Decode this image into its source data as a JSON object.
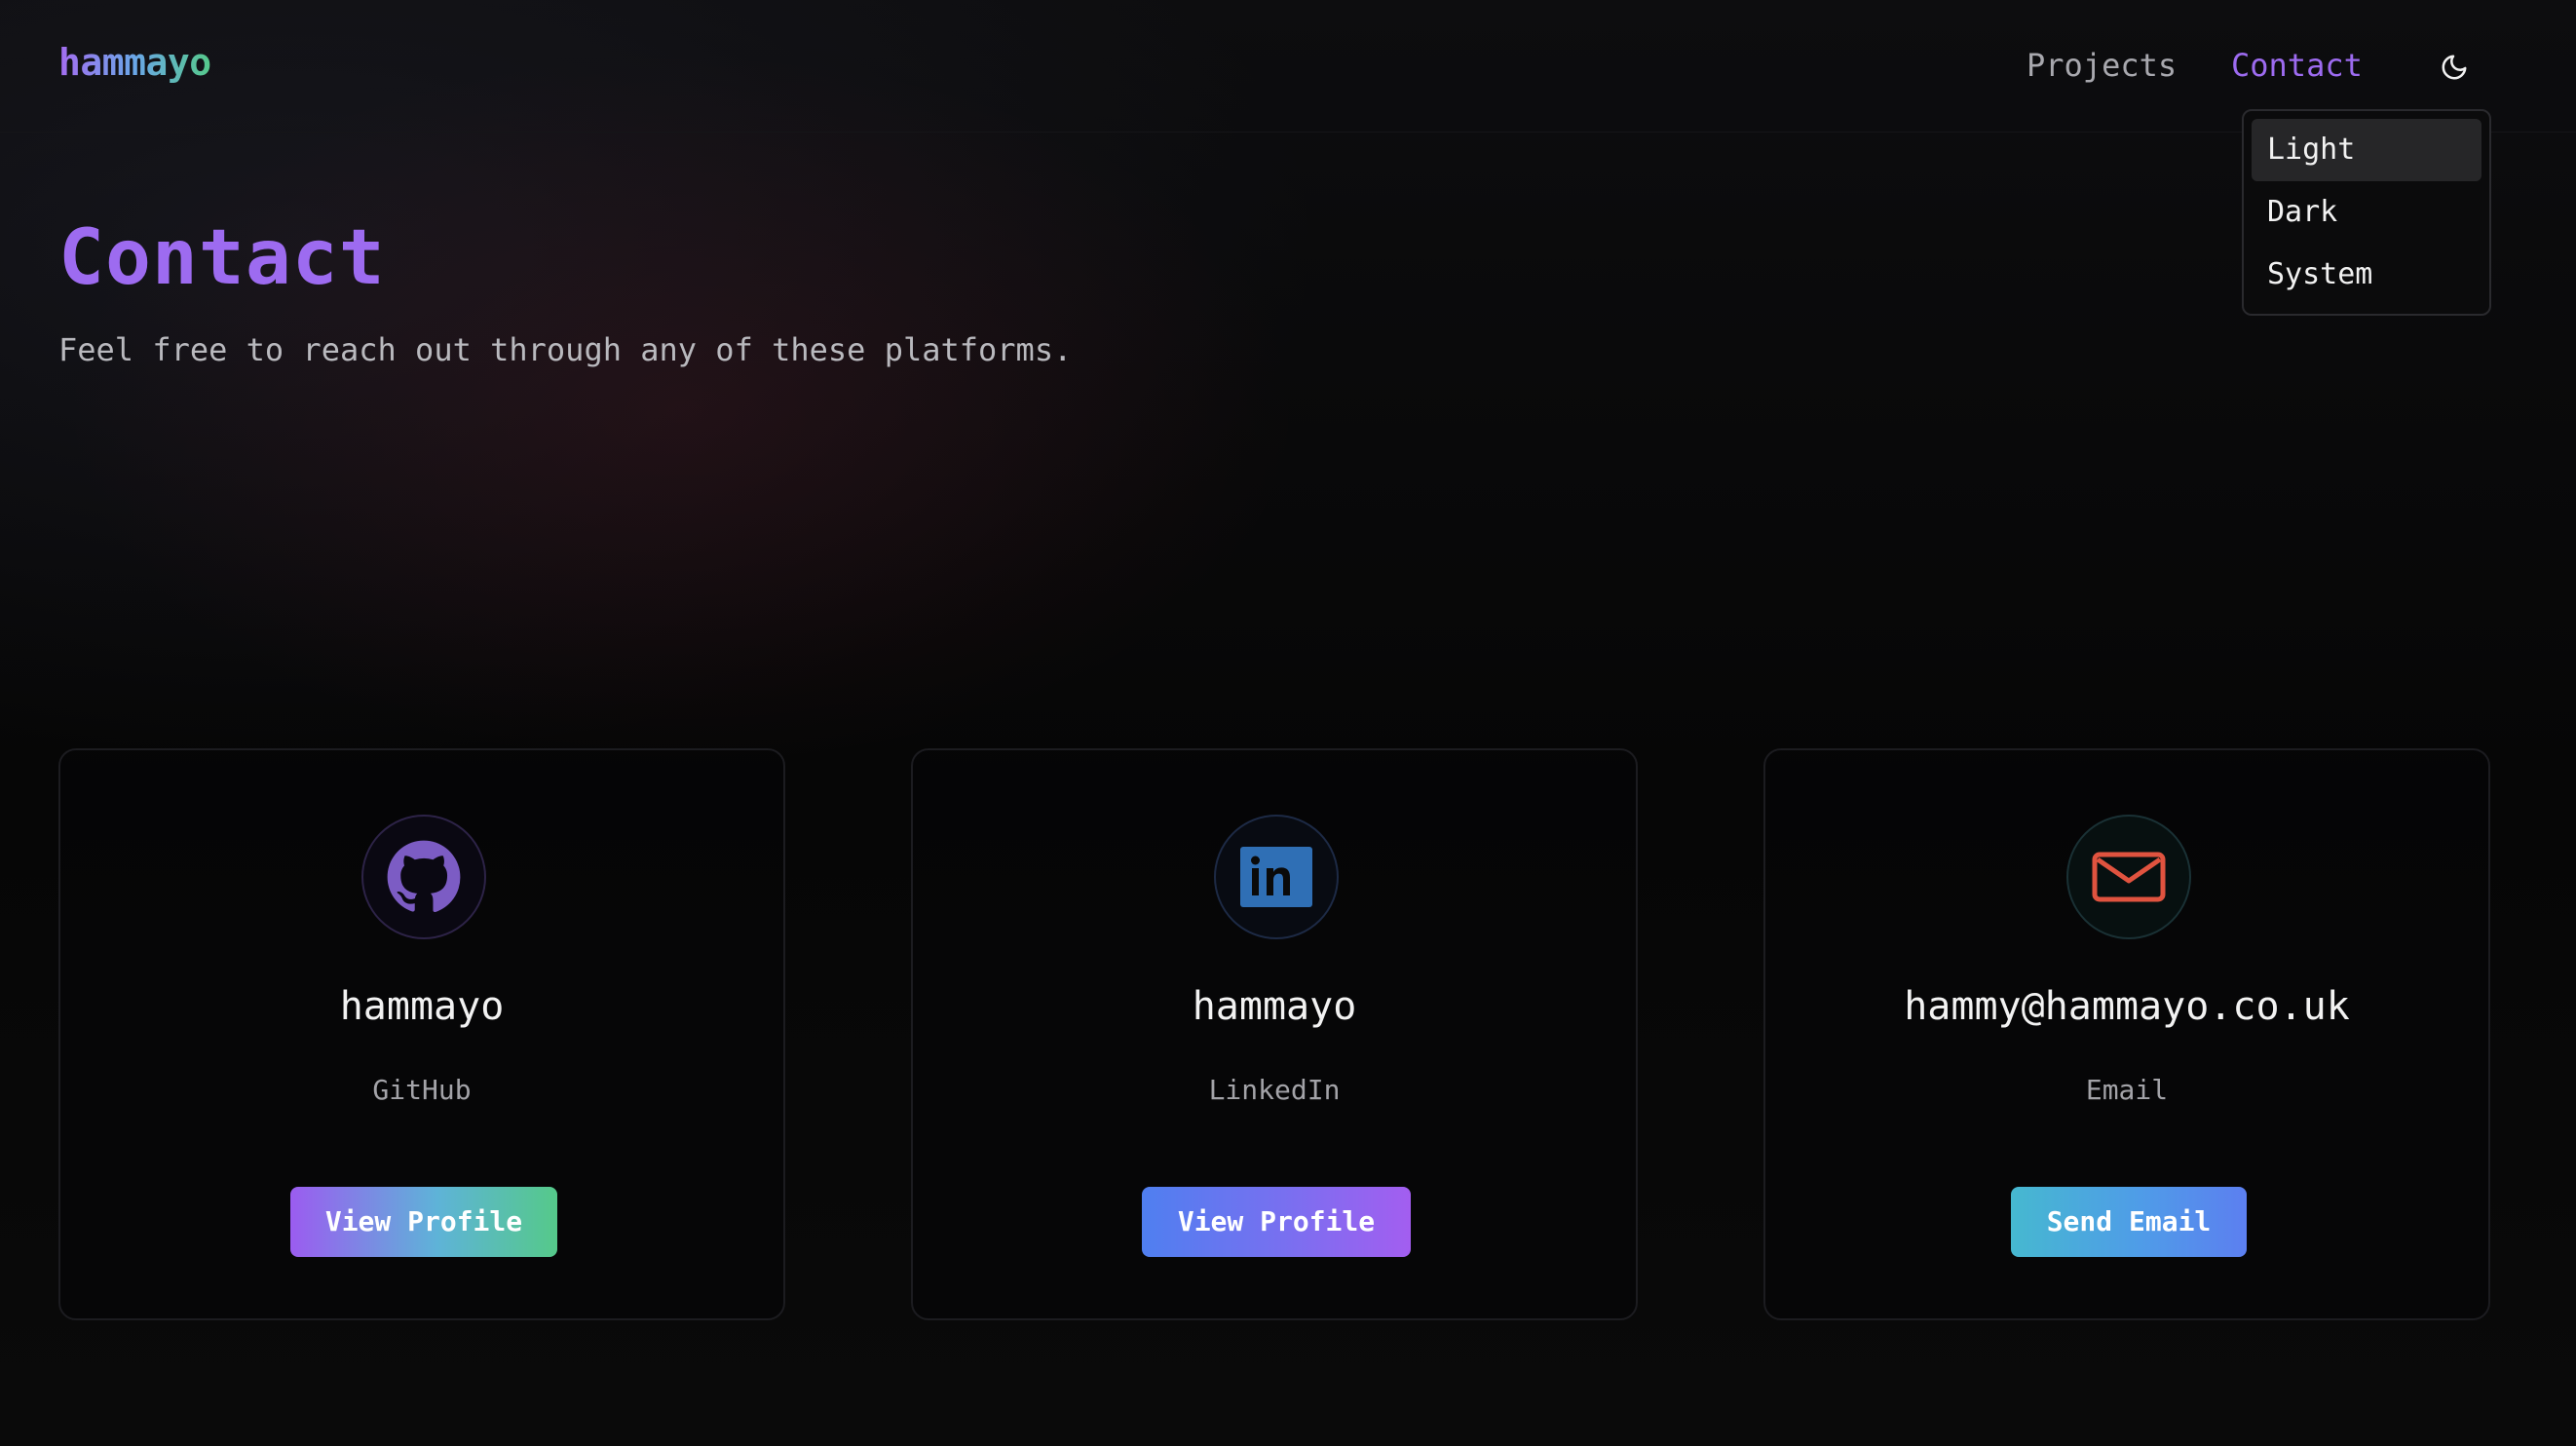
{
  "header": {
    "logo": "hammayo",
    "nav": {
      "projects": "Projects",
      "contact": "Contact"
    },
    "theme_toggle_icon": "moon-icon"
  },
  "theme_menu": {
    "items": [
      "Light",
      "Dark",
      "System"
    ],
    "highlighted": "Light"
  },
  "main": {
    "title": "Contact",
    "subtitle": "Feel free to reach out through any of these platforms."
  },
  "cards": [
    {
      "icon": "github-icon",
      "name": "hammayo",
      "platform": "GitHub",
      "button": "View Profile",
      "icon_color": "#7c5cc4"
    },
    {
      "icon": "linkedin-icon",
      "name": "hammayo",
      "platform": "LinkedIn",
      "button": "View Profile",
      "icon_color": "#2f6fb5"
    },
    {
      "icon": "mail-icon",
      "name": "hammy@hammayo.co.uk",
      "platform": "Email",
      "button": "Send Email",
      "icon_color": "#e0533f"
    }
  ],
  "colors": {
    "accent": "#9d6bf0",
    "background": "#050505"
  }
}
